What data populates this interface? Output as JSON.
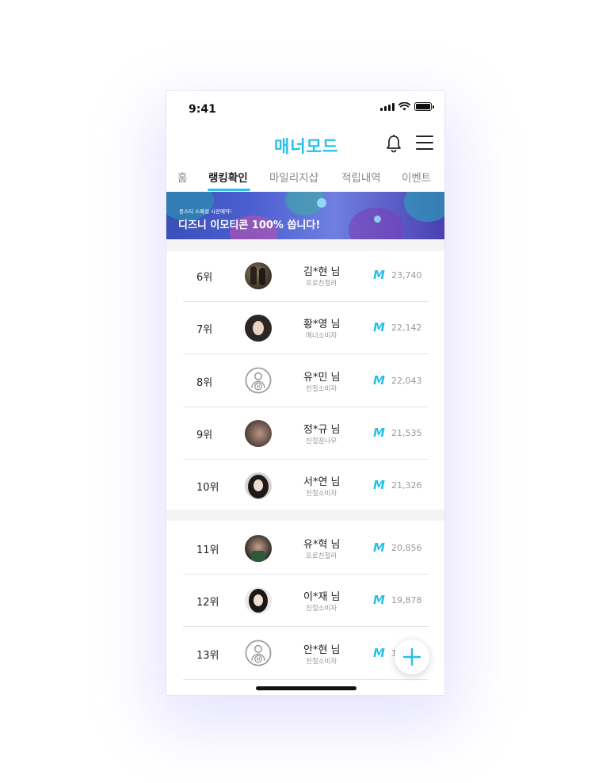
{
  "status": {
    "time": "9:41"
  },
  "header": {
    "logo": "매너모드",
    "bell_icon": "bell-icon",
    "menu_icon": "menu-icon"
  },
  "tabs": [
    {
      "label": "홈"
    },
    {
      "label": "랭킹확인",
      "active": true
    },
    {
      "label": "마일리지샵"
    },
    {
      "label": "적립내역"
    },
    {
      "label": "이벤트"
    }
  ],
  "banner": {
    "small_text": "몽스터 스페셜 사전예약!",
    "title": "디즈니 이모티콘 100% 쏩니다!"
  },
  "colors": {
    "accent": "#27c0e8"
  },
  "ranking": [
    {
      "rank": "6위",
      "name": "김*현 님",
      "grade": "프로친절러",
      "points": "23,740",
      "avatar": "photo"
    },
    {
      "rank": "7위",
      "name": "황*영 님",
      "grade": "매너소비자",
      "points": "22,142",
      "avatar": "photo"
    },
    {
      "rank": "8위",
      "name": "유*민 님",
      "grade": "친절소비자",
      "points": "22,043",
      "avatar": "default"
    },
    {
      "rank": "9위",
      "name": "정*규 님",
      "grade": "친절꿈나무",
      "points": "21,535",
      "avatar": "photo"
    },
    {
      "rank": "10위",
      "name": "서*연 님",
      "grade": "친절소비자",
      "points": "21,326",
      "avatar": "photo"
    },
    {
      "rank": "11위",
      "name": "유*혁 님",
      "grade": "프로친절러",
      "points": "20,856",
      "avatar": "photo"
    },
    {
      "rank": "12위",
      "name": "이*재 님",
      "grade": "친절소비자",
      "points": "19,878",
      "avatar": "photo"
    },
    {
      "rank": "13위",
      "name": "안*현 님",
      "grade": "친절소비자",
      "points": "1",
      "avatar": "default"
    }
  ],
  "mileage_icon": "M",
  "fab_icon": "plus-icon"
}
